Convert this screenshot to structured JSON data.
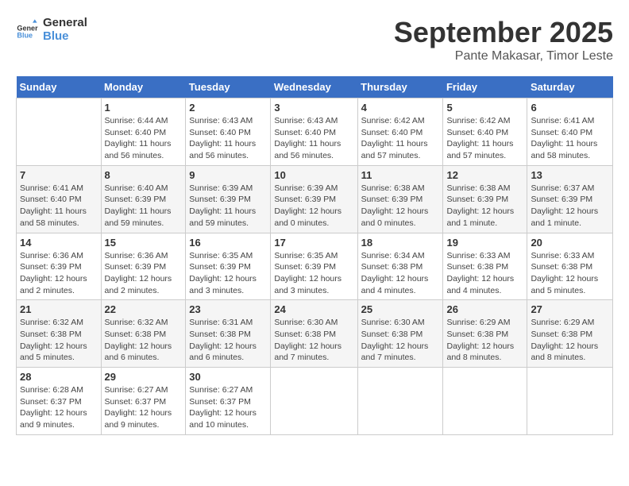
{
  "logo": {
    "line1": "General",
    "line2": "Blue"
  },
  "title": "September 2025",
  "subtitle": "Pante Makasar, Timor Leste",
  "days_of_week": [
    "Sunday",
    "Monday",
    "Tuesday",
    "Wednesday",
    "Thursday",
    "Friday",
    "Saturday"
  ],
  "weeks": [
    [
      {
        "day": "",
        "info": ""
      },
      {
        "day": "1",
        "info": "Sunrise: 6:44 AM\nSunset: 6:40 PM\nDaylight: 11 hours\nand 56 minutes."
      },
      {
        "day": "2",
        "info": "Sunrise: 6:43 AM\nSunset: 6:40 PM\nDaylight: 11 hours\nand 56 minutes."
      },
      {
        "day": "3",
        "info": "Sunrise: 6:43 AM\nSunset: 6:40 PM\nDaylight: 11 hours\nand 56 minutes."
      },
      {
        "day": "4",
        "info": "Sunrise: 6:42 AM\nSunset: 6:40 PM\nDaylight: 11 hours\nand 57 minutes."
      },
      {
        "day": "5",
        "info": "Sunrise: 6:42 AM\nSunset: 6:40 PM\nDaylight: 11 hours\nand 57 minutes."
      },
      {
        "day": "6",
        "info": "Sunrise: 6:41 AM\nSunset: 6:40 PM\nDaylight: 11 hours\nand 58 minutes."
      }
    ],
    [
      {
        "day": "7",
        "info": "Sunrise: 6:41 AM\nSunset: 6:40 PM\nDaylight: 11 hours\nand 58 minutes."
      },
      {
        "day": "8",
        "info": "Sunrise: 6:40 AM\nSunset: 6:39 PM\nDaylight: 11 hours\nand 59 minutes."
      },
      {
        "day": "9",
        "info": "Sunrise: 6:39 AM\nSunset: 6:39 PM\nDaylight: 11 hours\nand 59 minutes."
      },
      {
        "day": "10",
        "info": "Sunrise: 6:39 AM\nSunset: 6:39 PM\nDaylight: 12 hours\nand 0 minutes."
      },
      {
        "day": "11",
        "info": "Sunrise: 6:38 AM\nSunset: 6:39 PM\nDaylight: 12 hours\nand 0 minutes."
      },
      {
        "day": "12",
        "info": "Sunrise: 6:38 AM\nSunset: 6:39 PM\nDaylight: 12 hours\nand 1 minute."
      },
      {
        "day": "13",
        "info": "Sunrise: 6:37 AM\nSunset: 6:39 PM\nDaylight: 12 hours\nand 1 minute."
      }
    ],
    [
      {
        "day": "14",
        "info": "Sunrise: 6:36 AM\nSunset: 6:39 PM\nDaylight: 12 hours\nand 2 minutes."
      },
      {
        "day": "15",
        "info": "Sunrise: 6:36 AM\nSunset: 6:39 PM\nDaylight: 12 hours\nand 2 minutes."
      },
      {
        "day": "16",
        "info": "Sunrise: 6:35 AM\nSunset: 6:39 PM\nDaylight: 12 hours\nand 3 minutes."
      },
      {
        "day": "17",
        "info": "Sunrise: 6:35 AM\nSunset: 6:39 PM\nDaylight: 12 hours\nand 3 minutes."
      },
      {
        "day": "18",
        "info": "Sunrise: 6:34 AM\nSunset: 6:38 PM\nDaylight: 12 hours\nand 4 minutes."
      },
      {
        "day": "19",
        "info": "Sunrise: 6:33 AM\nSunset: 6:38 PM\nDaylight: 12 hours\nand 4 minutes."
      },
      {
        "day": "20",
        "info": "Sunrise: 6:33 AM\nSunset: 6:38 PM\nDaylight: 12 hours\nand 5 minutes."
      }
    ],
    [
      {
        "day": "21",
        "info": "Sunrise: 6:32 AM\nSunset: 6:38 PM\nDaylight: 12 hours\nand 5 minutes."
      },
      {
        "day": "22",
        "info": "Sunrise: 6:32 AM\nSunset: 6:38 PM\nDaylight: 12 hours\nand 6 minutes."
      },
      {
        "day": "23",
        "info": "Sunrise: 6:31 AM\nSunset: 6:38 PM\nDaylight: 12 hours\nand 6 minutes."
      },
      {
        "day": "24",
        "info": "Sunrise: 6:30 AM\nSunset: 6:38 PM\nDaylight: 12 hours\nand 7 minutes."
      },
      {
        "day": "25",
        "info": "Sunrise: 6:30 AM\nSunset: 6:38 PM\nDaylight: 12 hours\nand 7 minutes."
      },
      {
        "day": "26",
        "info": "Sunrise: 6:29 AM\nSunset: 6:38 PM\nDaylight: 12 hours\nand 8 minutes."
      },
      {
        "day": "27",
        "info": "Sunrise: 6:29 AM\nSunset: 6:38 PM\nDaylight: 12 hours\nand 8 minutes."
      }
    ],
    [
      {
        "day": "28",
        "info": "Sunrise: 6:28 AM\nSunset: 6:37 PM\nDaylight: 12 hours\nand 9 minutes."
      },
      {
        "day": "29",
        "info": "Sunrise: 6:27 AM\nSunset: 6:37 PM\nDaylight: 12 hours\nand 9 minutes."
      },
      {
        "day": "30",
        "info": "Sunrise: 6:27 AM\nSunset: 6:37 PM\nDaylight: 12 hours\nand 10 minutes."
      },
      {
        "day": "",
        "info": ""
      },
      {
        "day": "",
        "info": ""
      },
      {
        "day": "",
        "info": ""
      },
      {
        "day": "",
        "info": ""
      }
    ]
  ]
}
